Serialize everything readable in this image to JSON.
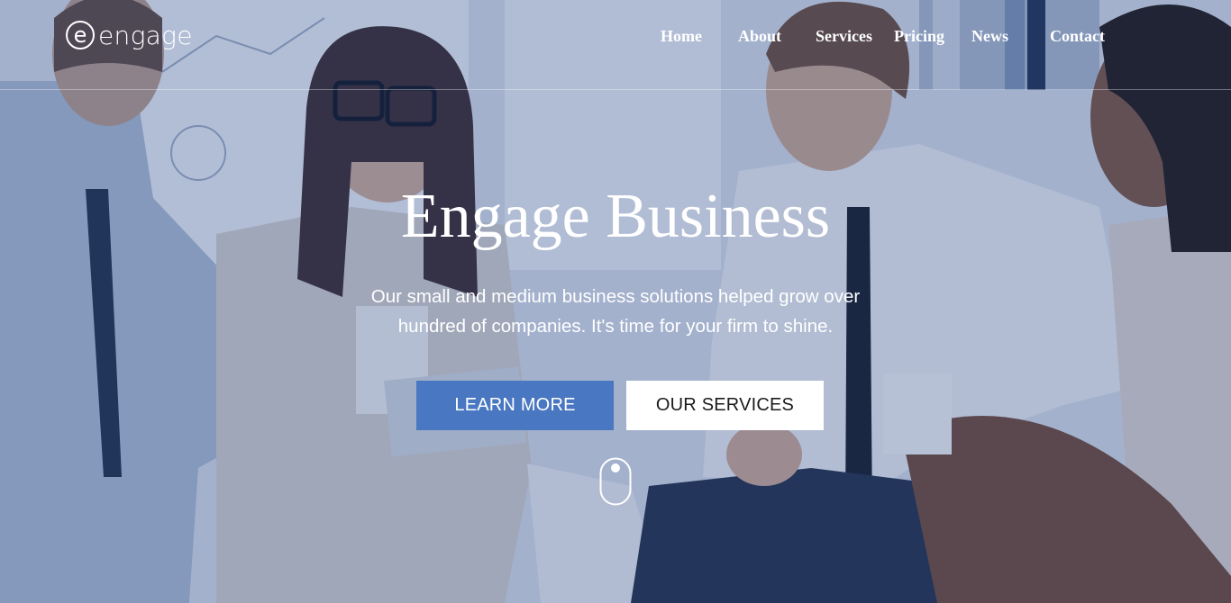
{
  "brand": {
    "logo_letter": "e",
    "logo_text": "engage"
  },
  "nav": {
    "items": [
      {
        "label": "Home"
      },
      {
        "label": "About"
      },
      {
        "label": "Services"
      },
      {
        "label": "Pricing"
      },
      {
        "label": "News"
      },
      {
        "label": "Contact"
      }
    ]
  },
  "hero": {
    "title": "Engage Business",
    "subtitle": "Our small and medium business solutions helped grow over hundred of companies. It's time for your firm to shine.",
    "primary_button": "LEARN MORE",
    "secondary_button": "OUR SERVICES",
    "scroll_icon": "mouse-scroll-icon"
  },
  "colors": {
    "primary_button": "#4a77c1",
    "secondary_button": "#ffffff",
    "overlay": "#284682"
  }
}
